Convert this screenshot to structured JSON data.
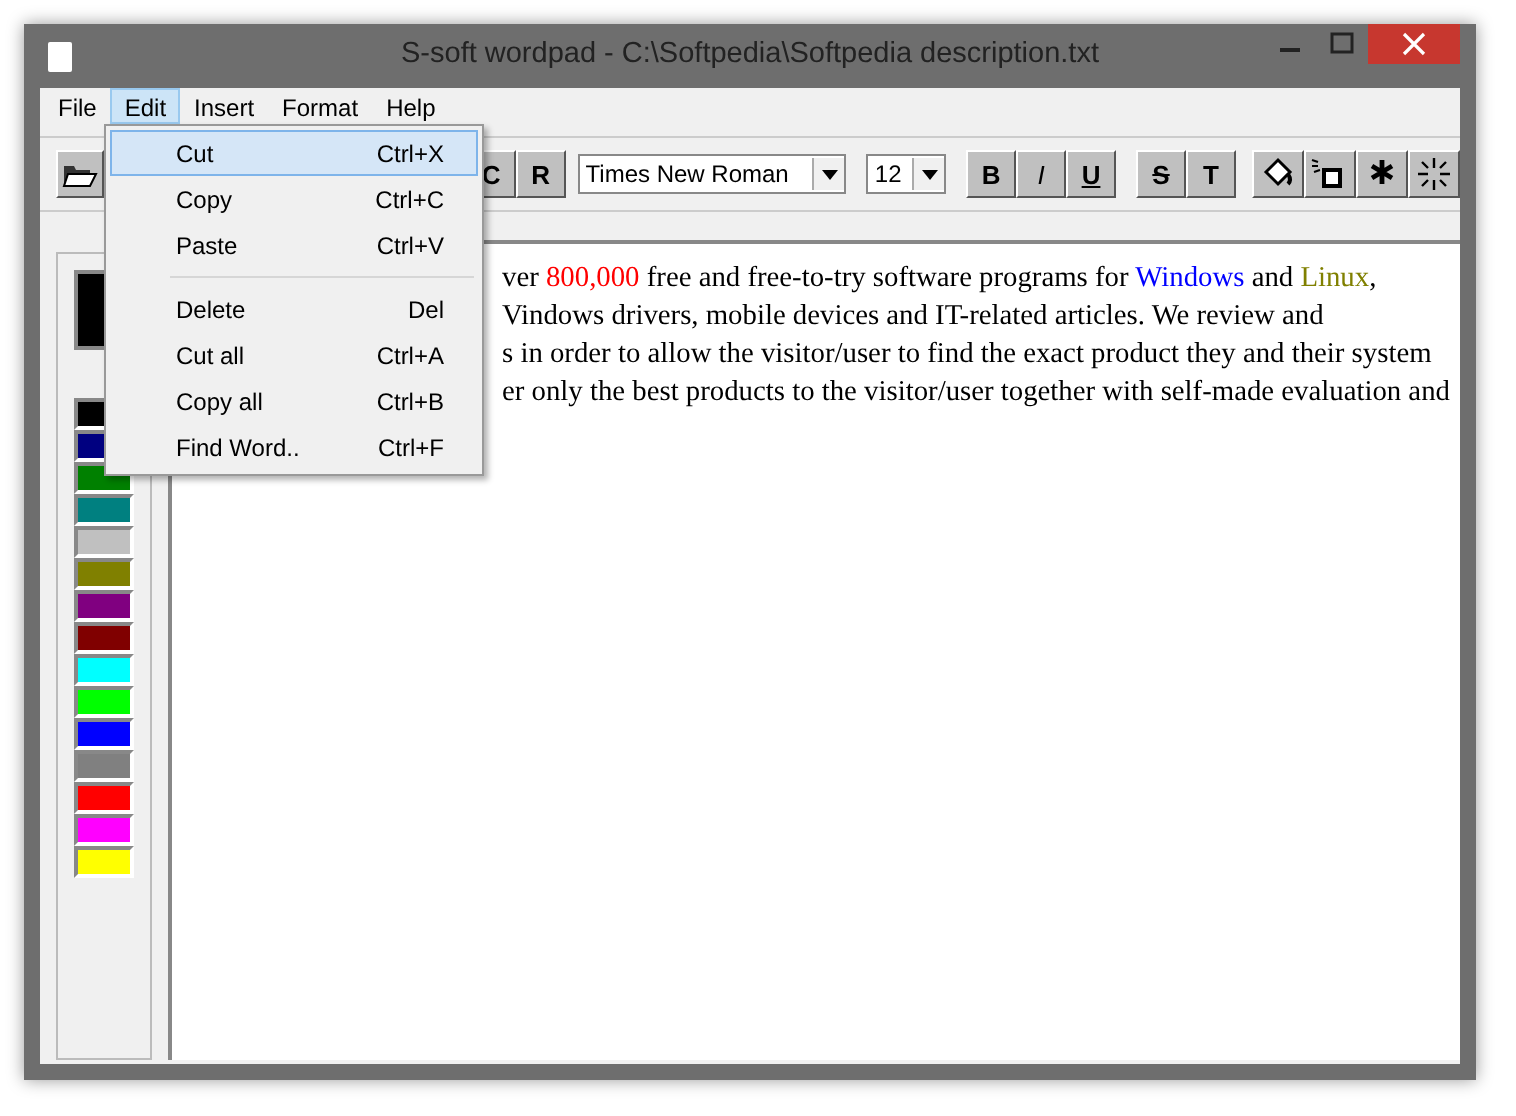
{
  "window": {
    "title": "S-soft wordpad - C:\\Softpedia\\Softpedia description.txt"
  },
  "menu_bar": [
    {
      "label": "File",
      "selected": false
    },
    {
      "label": "Edit",
      "selected": true
    },
    {
      "label": "Insert",
      "selected": false
    },
    {
      "label": "Format",
      "selected": false
    },
    {
      "label": "Help",
      "selected": false
    }
  ],
  "toolbar": {
    "align_buttons": [
      "C",
      "R"
    ],
    "font": "Times New Roman",
    "size": "12",
    "style_buttons": [
      {
        "label": "B",
        "kind": "bold"
      },
      {
        "label": "I",
        "kind": "italic"
      },
      {
        "label": "U",
        "kind": "underline"
      }
    ],
    "effect_buttons": [
      {
        "label": "S",
        "kind": "strike"
      },
      {
        "label": "T",
        "kind": "bold"
      }
    ],
    "tool_buttons": [
      {
        "kind": "bucket"
      },
      {
        "kind": "spray"
      },
      {
        "kind": "asterisk"
      },
      {
        "kind": "sparkle"
      }
    ]
  },
  "palette": {
    "current": {
      "color": "#000000"
    },
    "colors": [
      {
        "color": "#000000"
      },
      {
        "color": "#000080"
      },
      {
        "color": "#008000"
      },
      {
        "color": "#008080"
      },
      {
        "color": "#c0c0c0"
      },
      {
        "color": "#808000"
      },
      {
        "color": "#800080"
      },
      {
        "color": "#800000"
      },
      {
        "color": "#00ffff"
      },
      {
        "color": "#00ff00"
      },
      {
        "color": "#0000ff"
      },
      {
        "color": "#808080"
      },
      {
        "color": "#ff0000"
      },
      {
        "color": "#ff00ff"
      },
      {
        "color": "#ffff00"
      }
    ]
  },
  "document": {
    "lines": [
      [
        {
          "text": "ver ",
          "color": "#000000"
        },
        {
          "text": "800,000",
          "color": "#ff0000"
        },
        {
          "text": " free and free-to-try software programs for ",
          "color": "#000000"
        },
        {
          "text": "Windows",
          "color": "#0000ff"
        },
        {
          "text": " and ",
          "color": "#000000"
        },
        {
          "text": "Linux",
          "color": "#808000"
        },
        {
          "text": ",",
          "color": "#000000"
        }
      ],
      [
        {
          "text": "Vindows drivers, mobile devices and IT-related articles. We review and",
          "color": "#000000"
        }
      ],
      [
        {
          "text": "s in order to allow the visitor/user to find the exact product they and their system",
          "color": "#000000"
        }
      ],
      [
        {
          "text": "er only the best products to the visitor/user together with self-made evaluation and",
          "color": "#000000"
        }
      ]
    ]
  },
  "edit_menu": {
    "groups": [
      [
        {
          "label": "Cut",
          "shortcut": "Ctrl+X",
          "selected": true
        },
        {
          "label": "Copy",
          "shortcut": "Ctrl+C",
          "selected": false
        },
        {
          "label": "Paste",
          "shortcut": "Ctrl+V",
          "selected": false
        }
      ],
      [
        {
          "label": "Delete",
          "shortcut": "Del",
          "selected": false
        },
        {
          "label": "Cut all",
          "shortcut": "Ctrl+A",
          "selected": false
        },
        {
          "label": "Copy all",
          "shortcut": "Ctrl+B",
          "selected": false
        },
        {
          "label": "Find Word..",
          "shortcut": "Ctrl+F",
          "selected": false
        }
      ]
    ]
  }
}
